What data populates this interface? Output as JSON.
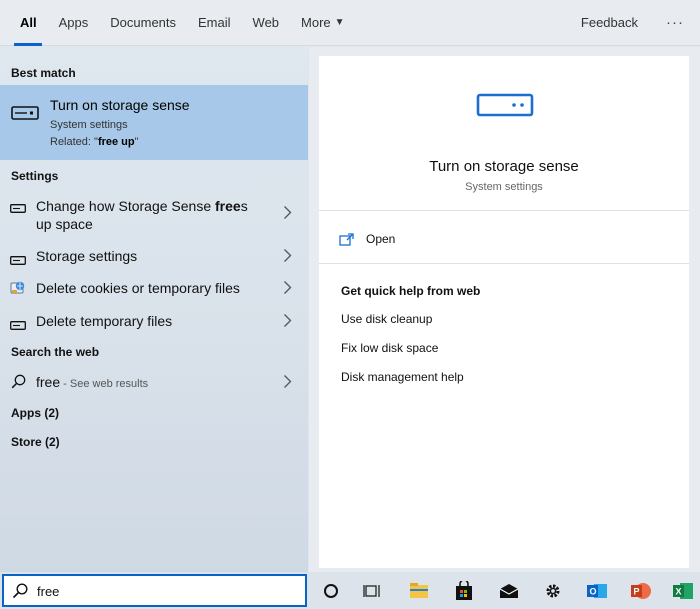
{
  "tabs": [
    {
      "label": "All",
      "active": true
    },
    {
      "label": "Apps"
    },
    {
      "label": "Documents"
    },
    {
      "label": "Email"
    },
    {
      "label": "Web"
    },
    {
      "label": "More"
    }
  ],
  "header": {
    "feedback": "Feedback",
    "more_options": "···"
  },
  "left": {
    "best_match_heading": "Best match",
    "best_match": {
      "title": "Turn on storage sense",
      "subtitle": "System settings",
      "related_prefix": "Related: \"",
      "related_term": "free up",
      "related_suffix": "\"",
      "icon": "storage-drive-icon"
    },
    "settings_heading": "Settings",
    "settings_items": [
      {
        "text_before": "Change how Storage Sense ",
        "bold": "free",
        "text_after": "s up space",
        "icon": "storage-drive-icon"
      },
      {
        "text": "Storage settings",
        "icon": "storage-drive-icon"
      },
      {
        "text": "Delete cookies or temporary files",
        "icon": "internet-options-icon"
      },
      {
        "text": "Delete temporary files",
        "icon": "storage-drive-icon"
      }
    ],
    "web_heading": "Search the web",
    "web_item": {
      "query": "free",
      "suffix": " - See web results",
      "icon": "search-icon"
    },
    "apps_heading": "Apps (2)",
    "store_heading": "Store (2)"
  },
  "preview": {
    "title": "Turn on storage sense",
    "subtitle": "System settings",
    "open_label": "Open",
    "help_heading": "Get quick help from web",
    "help_links": [
      "Use disk cleanup",
      "Fix low disk space",
      "Disk management help"
    ]
  },
  "taskbar": {
    "search_value": "free",
    "items": [
      "cortana-icon",
      "task-view-icon",
      "file-explorer-icon",
      "store-icon",
      "mail-icon",
      "settings-icon",
      "outlook-icon",
      "powerpoint-icon",
      "excel-icon"
    ]
  },
  "colors": {
    "accent": "#0a64c8",
    "selection": "#a7c8e8",
    "icon_blue": "#1a6fd0"
  }
}
